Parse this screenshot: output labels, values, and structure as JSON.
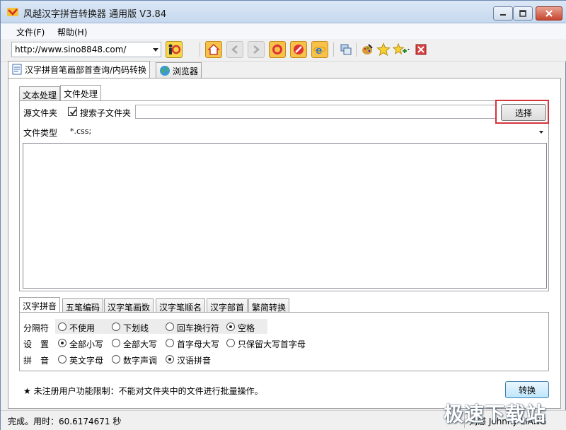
{
  "window": {
    "title": "风越汉字拼音转换器 通用版 V3.84",
    "accent_color": "#6d8ab0"
  },
  "menu": {
    "file": "文件(F)",
    "help": "帮助(H)"
  },
  "toolbar": {
    "url": "http://www.sino8848.com/",
    "icons": [
      "man-refresh-icon",
      "home-icon",
      "back-icon",
      "forward-icon",
      "refresh-icon",
      "stop-icon",
      "ie-icon",
      "window-icon",
      "paint-icon",
      "star-icon",
      "add-favorite-icon",
      "close-icon"
    ]
  },
  "outer_tabs": [
    {
      "label": "汉字拼音笔画部首查询/内码转换",
      "active": true
    },
    {
      "label": "浏览器",
      "active": false
    }
  ],
  "inner_tabs": [
    {
      "label": "文本处理",
      "active": false
    },
    {
      "label": "文件处理",
      "active": true
    }
  ],
  "file_panel": {
    "source_label": "源文件夹",
    "subfolder_label": "搜索子文件夹",
    "subfolder_checked": true,
    "choose_label": "选择",
    "filetype_label": "文件类型",
    "filetype_value": "*.css;"
  },
  "bottom_tabs": [
    "汉字拼音",
    "五笔编码",
    "汉字笔画数",
    "汉字笔顺名",
    "汉字部首",
    "繁简转换"
  ],
  "options": {
    "separator": {
      "label": "分隔符",
      "items": [
        "不使用",
        "下划线",
        "回车换行符",
        "空格"
      ],
      "selected": "空格"
    },
    "settings": {
      "label": "设　置",
      "items": [
        "全部小写",
        "全部大写",
        "首字母大写",
        "只保留大写首字母"
      ],
      "selected": "全部小写"
    },
    "pinyin": {
      "label": "拼　音",
      "items": [
        "英文字母",
        "数字声调",
        "汉语拼音"
      ],
      "selected": "汉语拼音"
    }
  },
  "notice": "★ 未注册用户功能限制：不能对文件夹中的文件进行批量操作。",
  "convert_label": "转换",
  "status": {
    "left": "完成。用时：60.6174671 秒",
    "right": "刘感 Johnny LIANG"
  },
  "watermark": "极速下载站"
}
